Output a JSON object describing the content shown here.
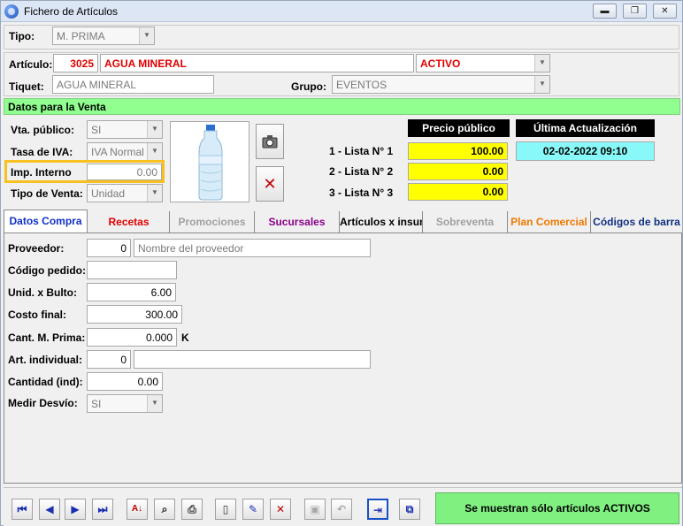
{
  "window": {
    "title": "Fichero de Artículos",
    "min": "▬",
    "max": "❐",
    "close": "✕"
  },
  "header": {
    "tipo_label": "Tipo:",
    "tipo_value": "M. PRIMA",
    "articulo_label": "Artículo:",
    "articulo_code": "3025",
    "articulo_name": "AGUA MINERAL",
    "estado_value": "ACTIVO",
    "tiquet_label": "Tiquet:",
    "tiquet_value": "AGUA MINERAL",
    "grupo_label": "Grupo:",
    "grupo_value": "EVENTOS"
  },
  "venta": {
    "section_title": "Datos para la Venta",
    "vta_publico_label": "Vta. público:",
    "vta_publico_value": "SI",
    "tasa_iva_label": "Tasa de IVA:",
    "tasa_iva_value": "IVA Normal",
    "imp_interno_label": "Imp. Interno",
    "imp_interno_value": "0.00",
    "tipo_venta_label": "Tipo de Venta:",
    "tipo_venta_value": "Unidad"
  },
  "precios": {
    "header": "Precio público",
    "lists": [
      {
        "label": "1 - Lista N° 1",
        "value": "100.00"
      },
      {
        "label": "2 - Lista N° 2",
        "value": "0.00"
      },
      {
        "label": "3 - Lista N° 3",
        "value": "0.00"
      }
    ],
    "update_header": "Última Actualización",
    "update_value": "02-02-2022 09:10"
  },
  "tabs": [
    {
      "label": "Datos Compra",
      "color": "#1030c8"
    },
    {
      "label": "Recetas",
      "color": "#e00000"
    },
    {
      "label": "Promociones",
      "color": "#a0a0a0"
    },
    {
      "label": "Sucursales",
      "color": "#8a008a"
    },
    {
      "label": "Artículos x insumo",
      "color": "#000000"
    },
    {
      "label": "Sobreventa",
      "color": "#a0a0a0"
    },
    {
      "label": "Plan Comercial",
      "color": "#f07800"
    },
    {
      "label": "Códigos de barra",
      "color": "#103080"
    }
  ],
  "compra": {
    "proveedor_label": "Proveedor:",
    "proveedor_code": "0",
    "proveedor_placeholder": "Nombre del proveedor",
    "codigo_pedido_label": "Código pedido:",
    "codigo_pedido_value": "",
    "unid_bulto_label": "Unid. x Bulto:",
    "unid_bulto_value": "6.00",
    "costo_final_label": "Costo final:",
    "costo_final_value": "300.00",
    "cant_mprima_label": "Cant. M. Prima:",
    "cant_mprima_value": "0.000",
    "cant_mprima_unit": "K",
    "art_individual_label": "Art. individual:",
    "art_individual_code": "0",
    "art_individual_name": "",
    "cantidad_ind_label": "Cantidad (ind):",
    "cantidad_ind_value": "0.00",
    "medir_desvio_label": "Medir Desvío:",
    "medir_desvio_value": "SI"
  },
  "status": {
    "label": "Se muestran sólo artículos ACTIVOS"
  }
}
